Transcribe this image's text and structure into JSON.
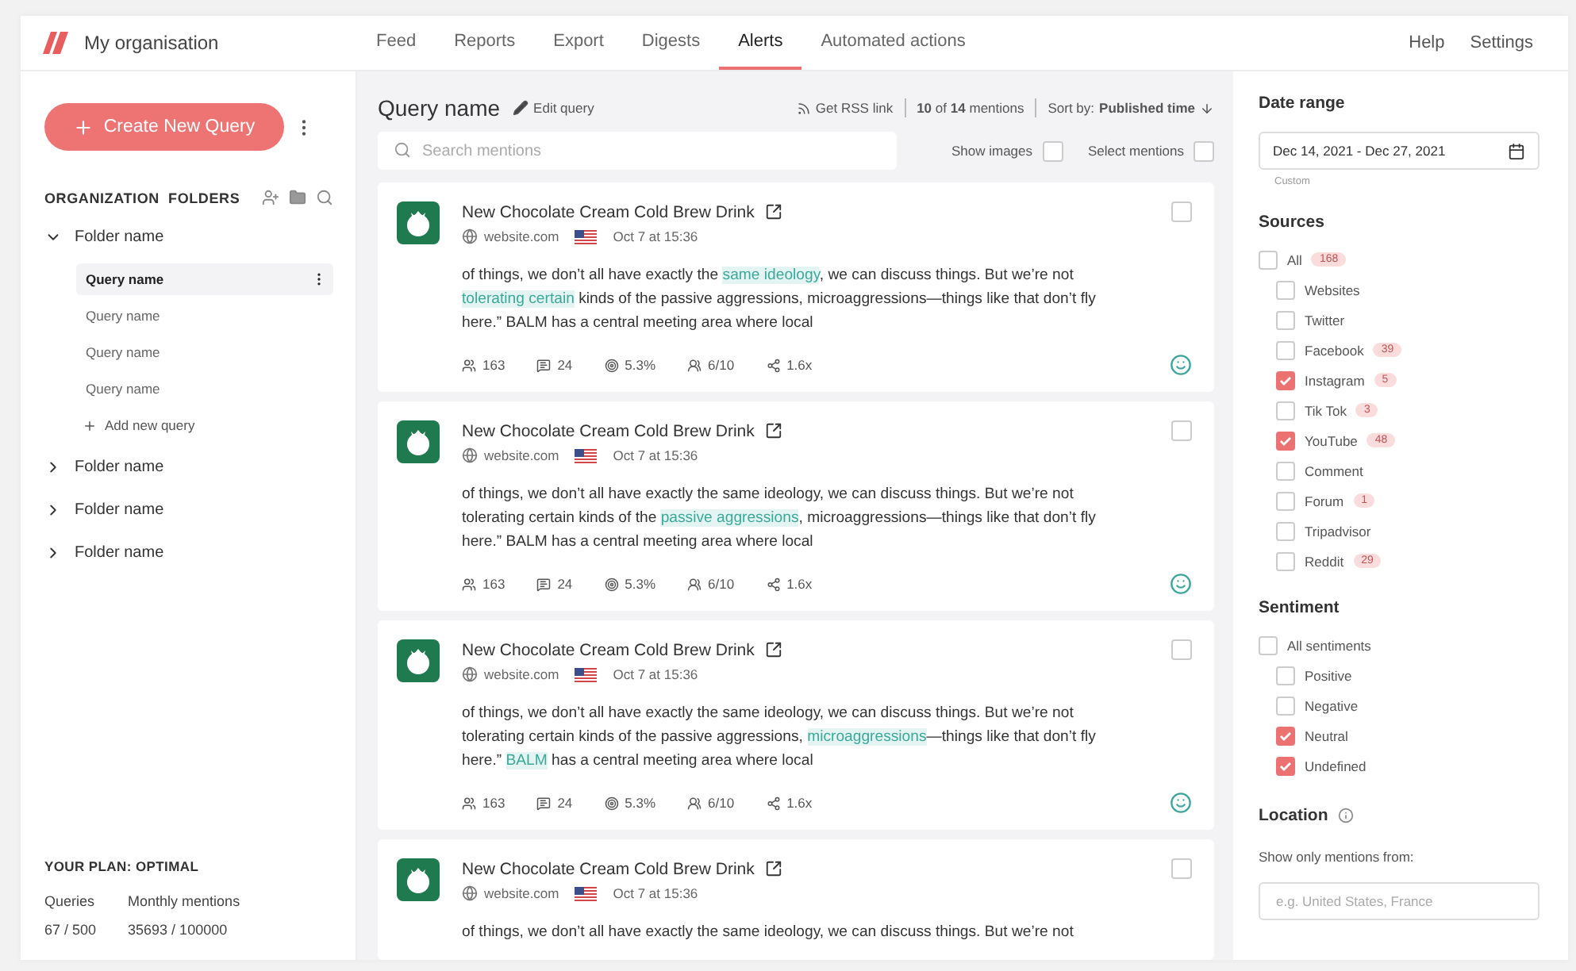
{
  "org": {
    "name": "My organisation"
  },
  "nav": [
    {
      "label": "Feed",
      "selected": false
    },
    {
      "label": "Reports",
      "selected": false
    },
    {
      "label": "Export",
      "selected": false
    },
    {
      "label": "Digests",
      "selected": false
    },
    {
      "label": "Alerts",
      "selected": true
    },
    {
      "label": "Automated actions",
      "selected": false
    }
  ],
  "nav_right": [
    "Help",
    "Settings"
  ],
  "sidebar": {
    "create_button": "Create New Query",
    "folders_title": "ORGANIZATION  FOLDERS",
    "folders": [
      {
        "name": "Folder name",
        "expanded": true,
        "children": [
          {
            "name": "Query name",
            "selected": true
          },
          {
            "name": "Query name",
            "selected": false
          },
          {
            "name": "Query name",
            "selected": false
          },
          {
            "name": "Query name",
            "selected": false
          }
        ],
        "add_label": "Add new query"
      },
      {
        "name": "Folder name",
        "expanded": false
      },
      {
        "name": "Folder name",
        "expanded": false
      },
      {
        "name": "Folder name",
        "expanded": false
      }
    ],
    "plan": {
      "title": "YOUR PLAN: OPTIMAL",
      "stats": [
        {
          "label": "Queries",
          "value": "67 / 500"
        },
        {
          "label": "Monthly mentions",
          "value": "35693 / 100000"
        }
      ]
    }
  },
  "main": {
    "title": "Query name",
    "edit": "Edit query",
    "rss": "Get RSS link",
    "count": {
      "shown": "10",
      "of": "of",
      "total": "14",
      "unit": "mentions"
    },
    "sort_label": "Sort by:",
    "sort_value": "Published time",
    "search": {
      "placeholder": "Search mentions"
    },
    "toggles": [
      {
        "label": "Show images",
        "checked": false
      },
      {
        "label": "Select mentions",
        "checked": false
      }
    ],
    "mentions": [
      {
        "title": "New Chocolate Cream Cold Brew Drink",
        "site": "website.com",
        "date": "Oct 7 at 15:36",
        "checked": false,
        "segments": [
          {
            "text": "of things, we don’t all have exactly the ",
            "highlight": false
          },
          {
            "text": "same ideology",
            "highlight": true
          },
          {
            "text": ", we can discuss things. But we’re not ",
            "highlight": false
          },
          {
            "text": "tolerating certain",
            "highlight": true
          },
          {
            "text": " kinds of the passive aggressions, microaggressions—things like that don’t fly here.” BALM has a central meeting area where local",
            "highlight": false
          }
        ],
        "stats": [
          "163",
          "24",
          "5.3%",
          "6/10",
          "1.6x"
        ]
      },
      {
        "title": "New Chocolate Cream Cold Brew Drink",
        "site": "website.com",
        "date": "Oct 7 at 15:36",
        "checked": false,
        "segments": [
          {
            "text": "of things, we don’t all have exactly the same ideology, we can discuss things. But we’re not tolerating certain kinds of the ",
            "highlight": false
          },
          {
            "text": "passive aggressions",
            "highlight": true
          },
          {
            "text": ", microaggressions—things like that don’t fly here.” BALM has a central meeting area where local",
            "highlight": false
          }
        ],
        "stats": [
          "163",
          "24",
          "5.3%",
          "6/10",
          "1.6x"
        ]
      },
      {
        "title": "New Chocolate Cream Cold Brew Drink",
        "site": "website.com",
        "date": "Oct 7 at 15:36",
        "checked": false,
        "segments": [
          {
            "text": "of things, we don’t all have exactly the same ideology, we can discuss things. But we’re not tolerating certain kinds of the passive aggressions, ",
            "highlight": false
          },
          {
            "text": "microaggressions",
            "highlight": true
          },
          {
            "text": "—things like that don’t fly here.” ",
            "highlight": false
          },
          {
            "text": "BALM",
            "highlight": true
          },
          {
            "text": " has a central meeting area where local",
            "highlight": false
          }
        ],
        "stats": [
          "163",
          "24",
          "5.3%",
          "6/10",
          "1.6x"
        ]
      },
      {
        "title": "New Chocolate Cream Cold Brew Drink",
        "site": "website.com",
        "date": "Oct 7 at 15:36",
        "checked": false,
        "segments": [
          {
            "text": "of things, we don’t all have exactly the same ideology, we can discuss things. But we’re not",
            "highlight": false
          }
        ]
      }
    ]
  },
  "filters": {
    "date_title": "Date range",
    "date_value": "Dec 14, 2021 - Dec 27, 2021",
    "date_hint": "Custom",
    "sources_title": "Sources",
    "sources_all": {
      "label": "All",
      "count": "168",
      "checked": false
    },
    "sources": [
      {
        "label": "Websites",
        "checked": false
      },
      {
        "label": "Twitter",
        "checked": false
      },
      {
        "label": "Facebook",
        "count": "39",
        "checked": false
      },
      {
        "label": "Instagram",
        "count": "5",
        "checked": true
      },
      {
        "label": "Tik Tok",
        "count": "3",
        "checked": false
      },
      {
        "label": "YouTube",
        "count": "48",
        "checked": true
      },
      {
        "label": "Comment",
        "checked": false
      },
      {
        "label": "Forum",
        "count": "1",
        "checked": false
      },
      {
        "label": "Tripadvisor",
        "checked": false
      },
      {
        "label": "Reddit",
        "count": "29",
        "checked": false
      }
    ],
    "sentiment_title": "Sentiment",
    "sentiment_all": {
      "label": "All sentiments",
      "checked": false
    },
    "sentiments": [
      {
        "label": "Positive",
        "checked": false
      },
      {
        "label": "Negative",
        "checked": false
      },
      {
        "label": "Neutral",
        "checked": true
      },
      {
        "label": "Undefined",
        "checked": true
      }
    ],
    "location_title": "Location",
    "location_label": "Show only mentions from:",
    "location": {
      "placeholder": "e.g. United States, France"
    }
  }
}
